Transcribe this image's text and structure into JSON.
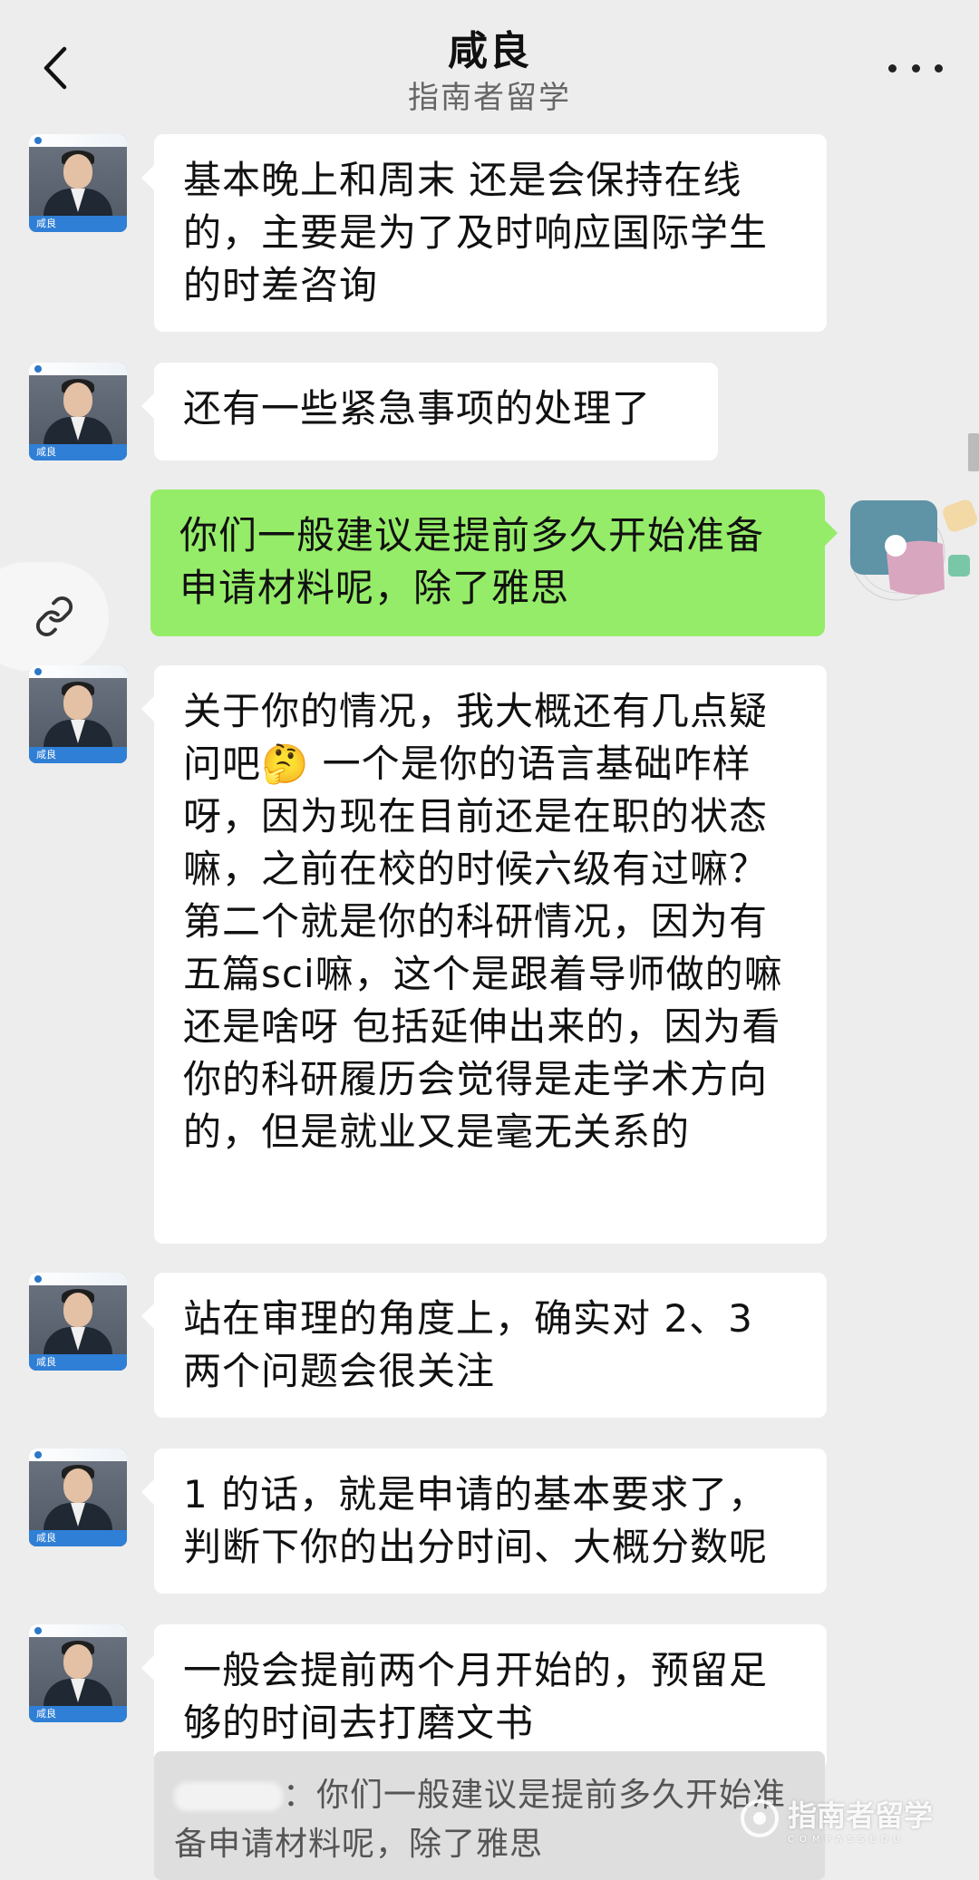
{
  "header": {
    "title": "咸良",
    "subtitle": "指南者留学"
  },
  "avatar": {
    "name_tag": "咸良"
  },
  "messages": [
    {
      "side": "left",
      "text": "基本晚上和周末 还是会保持在线的，主要是为了及时响应国际学生的时差咨询"
    },
    {
      "side": "left",
      "text": "还有一些紧急事项的处理了"
    },
    {
      "side": "right",
      "text": "你们一般建议是提前多久开始准备申请材料呢，除了雅思"
    },
    {
      "side": "left",
      "text": "关于你的情况，我大概还有几点疑问吧🤔 一个是你的语言基础咋样呀，因为现在目前还是在职的状态嘛，之前在校的时候六级有过嘛？ 第二个就是你的科研情况，因为有五篇sci嘛，这个是跟着导师做的嘛还是啥呀 包括延伸出来的，因为看你的科研履历会觉得是走学术方向的，但是就业又是毫无关系的"
    },
    {
      "side": "left",
      "text": "站在审理的角度上，确实对 2、3 两个问题会很关注"
    },
    {
      "side": "left",
      "text": "1 的话，就是申请的基本要求了，判断下你的出分时间、大概分数呢"
    },
    {
      "side": "left",
      "text": "一般会提前两个月开始的，预留足够的时间去打磨文书"
    }
  ],
  "quote": {
    "text": "：你们一般建议是提前多久开始准备申请材料呢，除了雅思"
  },
  "watermark": {
    "text": "指南者留学",
    "sub": "COMPASSEDU"
  },
  "colors": {
    "background": "#ededed",
    "incoming_bubble": "#ffffff",
    "outgoing_bubble": "#95ec69",
    "avatar_tag": "#2f7fd6"
  },
  "icons": [
    "back-arrow-icon",
    "more-dots-icon",
    "link-icon"
  ]
}
